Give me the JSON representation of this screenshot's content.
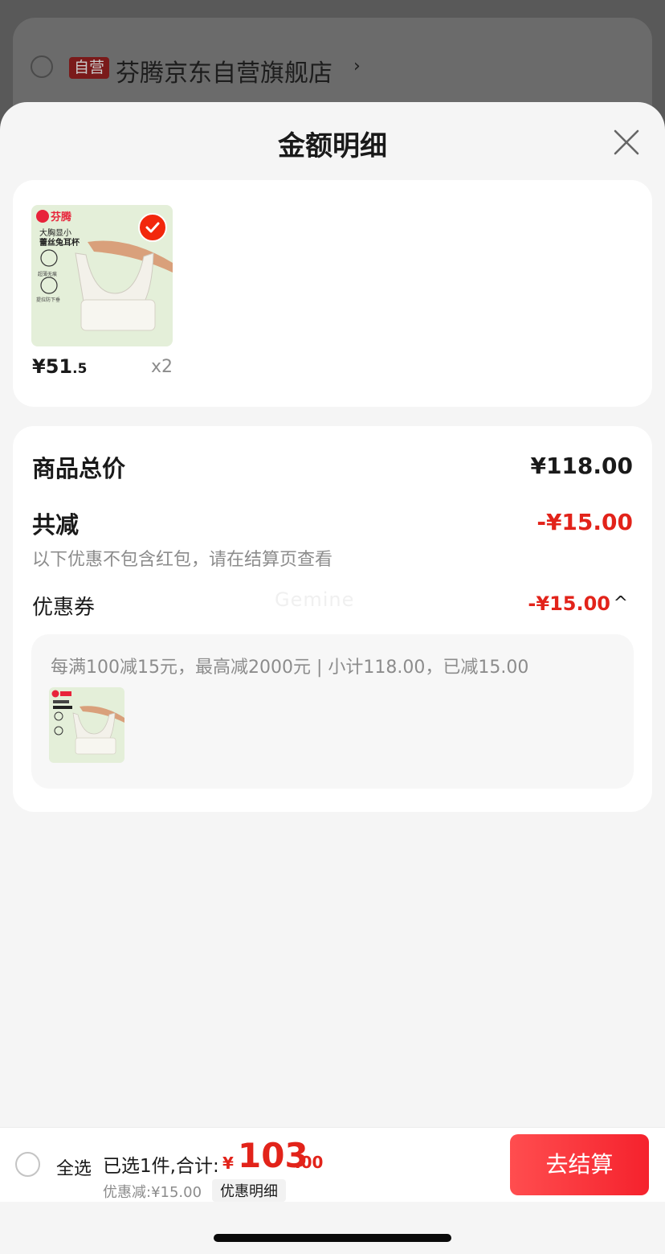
{
  "background": {
    "store": {
      "tag": "自营",
      "name": "芬腾京东自营旗舰店",
      "chevron": "›"
    }
  },
  "sheet": {
    "title": "金额明细",
    "close_icon": "close-icon"
  },
  "product": {
    "brand": "芬腾",
    "image_caption_line1": "大胸显小",
    "image_caption_line2": "蕾丝兔耳杯",
    "image_feature1": "超薄无痕",
    "image_feature2": "提拉防下垂",
    "price_int": "¥51",
    "price_dec": ".5",
    "quantity": "x2"
  },
  "detail": {
    "goods_total_label": "商品总价",
    "goods_total_value": "¥118.00",
    "reduction_label": "共减",
    "reduction_value": "-¥15.00",
    "reduction_note": "以下优惠不包含红包，请在结算页查看",
    "coupon_label": "优惠券",
    "coupon_value": "-¥15.00",
    "coupon_toggle": "^",
    "watermark": "Gemine",
    "coupon_desc": "每满100减15元，最高减2000元 | 小计118.00，已减15.00"
  },
  "checkout": {
    "select_all": "全选",
    "summary": "已选1件,合计:",
    "total_yen": "¥",
    "total_int": "103",
    "total_dec": ".00",
    "discount_note": "优惠减:¥15.00",
    "detail_link": "优惠明细",
    "checkout_button": "去结算"
  },
  "colors": {
    "accent": "#e2231a",
    "sheet_bg": "#f5f5f5",
    "card_bg": "#ffffff"
  }
}
